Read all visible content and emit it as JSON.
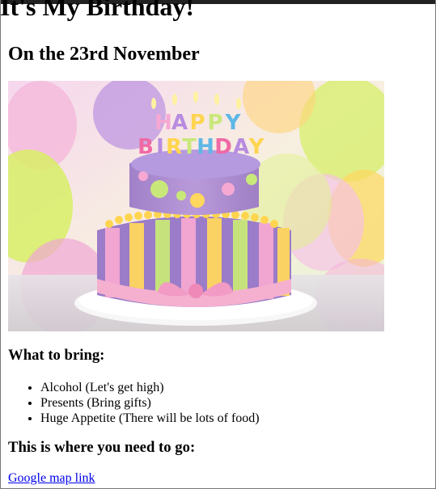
{
  "page": {
    "title": "It's My Birthday!",
    "subtitle": "On the 23rd November"
  },
  "hero_image": {
    "alt": "Birthday cake",
    "cake_text_top": "HAPPY",
    "cake_text_bottom": "BIRTHDAY"
  },
  "bring": {
    "heading": "What to bring:",
    "items": [
      "Alcohol (Let's get high)",
      "Presents (Bring gifts)",
      "Huge Appetite (There will be lots of food)"
    ]
  },
  "directions": {
    "heading": "This is where you need to go:",
    "link_text": "Google map link"
  },
  "colors": {
    "link": "#0000ee",
    "top_bar": "#222222"
  }
}
